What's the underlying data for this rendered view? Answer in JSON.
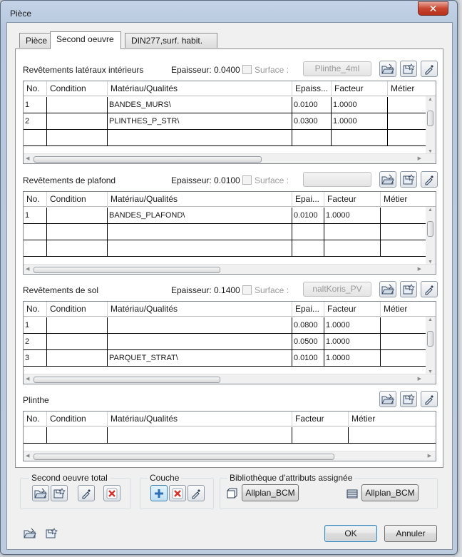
{
  "window": {
    "title": "Pièce",
    "close_glyph": "✕"
  },
  "tabs": [
    {
      "label": "Pièce"
    },
    {
      "label": "Second oeuvre"
    },
    {
      "label": "DIN277,surf. habit."
    }
  ],
  "lateral": {
    "title": "Revêtements latéraux intérieurs",
    "thickness_label": "Epaisseur: 0.0400",
    "surface_label": "Surface :",
    "combo": "Plinthe_4ml",
    "headers": [
      "No.",
      "Condition",
      "Matériau/Qualités",
      "Epaiss...",
      "Facteur",
      "Métier"
    ],
    "rows": [
      [
        "1",
        "",
        "BANDES_MURS\\",
        "0.0100",
        "1.0000",
        ""
      ],
      [
        "2",
        "",
        "PLINTHES_P_STR\\",
        "0.0300",
        "1.0000",
        ""
      ],
      [
        "",
        "",
        "",
        "",
        "",
        ""
      ]
    ]
  },
  "ceiling": {
    "title": "Revêtements de plafond",
    "thickness_label": "Epaisseur: 0.0100",
    "surface_label": "Surface :",
    "combo": "",
    "headers": [
      "No.",
      "Condition",
      "Matériau/Qualités",
      "Epai...",
      "Facteur",
      "Métier"
    ],
    "rows": [
      [
        "1",
        "",
        "BANDES_PLAFOND\\",
        "0.0100",
        "1.0000",
        ""
      ],
      [
        "",
        "",
        "",
        "",
        "",
        ""
      ],
      [
        "",
        "",
        "",
        "",
        "",
        ""
      ]
    ]
  },
  "floor": {
    "title": "Revêtements de sol",
    "thickness_label": "Epaisseur: 0.1400",
    "surface_label": "Surface :",
    "combo": "naltKoris_PV",
    "headers": [
      "No.",
      "Condition",
      "Matériau/Qualités",
      "Epai...",
      "Facteur",
      "Métier"
    ],
    "rows": [
      [
        "1",
        "",
        "",
        "0.0800",
        "1.0000",
        ""
      ],
      [
        "2",
        "",
        "",
        "0.0500",
        "1.0000",
        ""
      ],
      [
        "3",
        "",
        "PARQUET_STRAT\\",
        "0.0100",
        "1.0000",
        ""
      ]
    ]
  },
  "plinthe": {
    "title": "Plinthe",
    "headers": [
      "No.",
      "Condition",
      "Matériau/Qualités",
      "Facteur",
      "Métier"
    ],
    "rows": [
      [
        "",
        "",
        "",
        "",
        ""
      ]
    ]
  },
  "groups": {
    "total": "Second oeuvre total",
    "couche": "Couche",
    "library": "Bibliothèque d'attributs assignée"
  },
  "library_buttons": [
    "Allplan_BCM",
    "Allplan_BCM"
  ],
  "footer": {
    "ok": "OK",
    "cancel": "Annuler"
  },
  "icons": [
    "open-folder-icon",
    "favorite-save-icon",
    "eyedropper-icon",
    "delete-icon",
    "add-icon",
    "layer-icon",
    "library-icon"
  ],
  "colors": {
    "accent": "#3c7fb1",
    "delete": "#d9322a",
    "add": "#2f6fb8",
    "titlebar": "#c4d3e6"
  }
}
